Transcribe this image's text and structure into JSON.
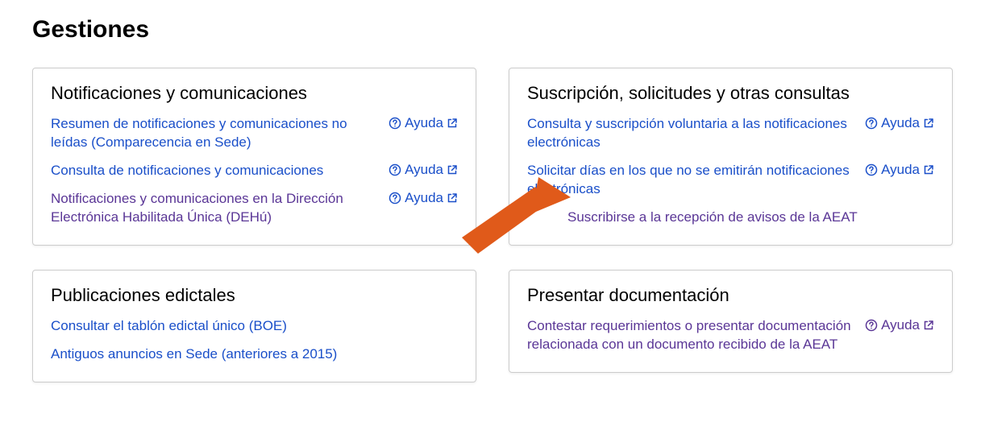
{
  "page_title": "Gestiones",
  "help_label": "Ayuda",
  "colors": {
    "link": "#1a4fc9",
    "visited": "#5a3696",
    "arrow": "#e05a1a"
  },
  "cards": {
    "notificaciones": {
      "title": "Notificaciones y comunicaciones",
      "items": [
        {
          "label": "Resumen de notificaciones y comunicaciones no leídas (Comparecencia en Sede)",
          "has_help": true,
          "visited": false
        },
        {
          "label": "Consulta de notificaciones y comunicaciones",
          "has_help": true,
          "visited": false
        },
        {
          "label": "Notificaciones y comunicaciones en la Dirección Electrónica Habilitada Única (DEHú)",
          "has_help": true,
          "visited": true
        }
      ]
    },
    "publicaciones": {
      "title": "Publicaciones edictales",
      "items": [
        {
          "label": "Consultar el tablón edictal único (BOE)",
          "has_help": false,
          "visited": false
        },
        {
          "label": "Antiguos anuncios en Sede (anteriores a 2015)",
          "has_help": false,
          "visited": false
        }
      ]
    },
    "suscripcion": {
      "title": "Suscripción, solicitudes y otras consultas",
      "items": [
        {
          "label": "Consulta y suscripción voluntaria a las notificaciones electrónicas",
          "has_help": true,
          "visited": false
        },
        {
          "label": "Solicitar días en los que no se emitirán notificaciones electrónicas",
          "has_help": true,
          "visited": false
        },
        {
          "label": "Suscribirse a la recepción de avisos de la AEAT",
          "has_help": false,
          "visited": true,
          "indented": true
        }
      ]
    },
    "presentar": {
      "title": "Presentar documentación",
      "items": [
        {
          "label": "Contestar requerimientos o presentar documentación relacionada con un documento recibido de la AEAT",
          "has_help": true,
          "visited": true
        }
      ]
    }
  }
}
